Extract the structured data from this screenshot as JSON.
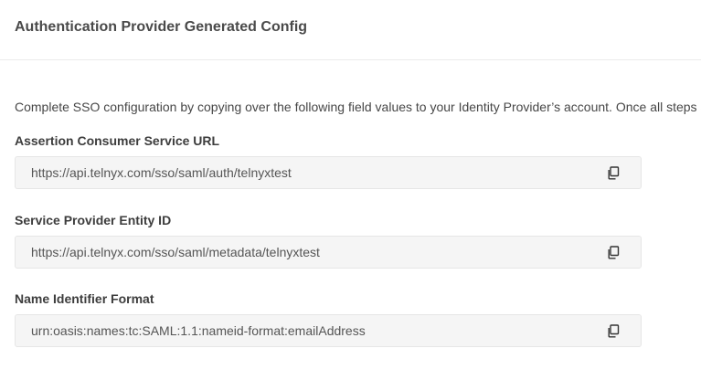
{
  "header": {
    "title": "Authentication Provider Generated Config"
  },
  "intro_text": "Complete SSO configuration by copying over the following field values to your Identity Provider’s account. Once all steps are completed",
  "fields": [
    {
      "label": "Assertion Consumer Service URL",
      "value": "https://api.telnyx.com/sso/saml/auth/telnyxtest",
      "icon": "copy-icon"
    },
    {
      "label": "Service Provider Entity ID",
      "value": "https://api.telnyx.com/sso/saml/metadata/telnyxtest",
      "icon": "copy-icon"
    },
    {
      "label": "Name Identifier Format",
      "value": "urn:oasis:names:tc:SAML:1.1:nameid-format:emailAddress",
      "icon": "copy-icon"
    }
  ]
}
